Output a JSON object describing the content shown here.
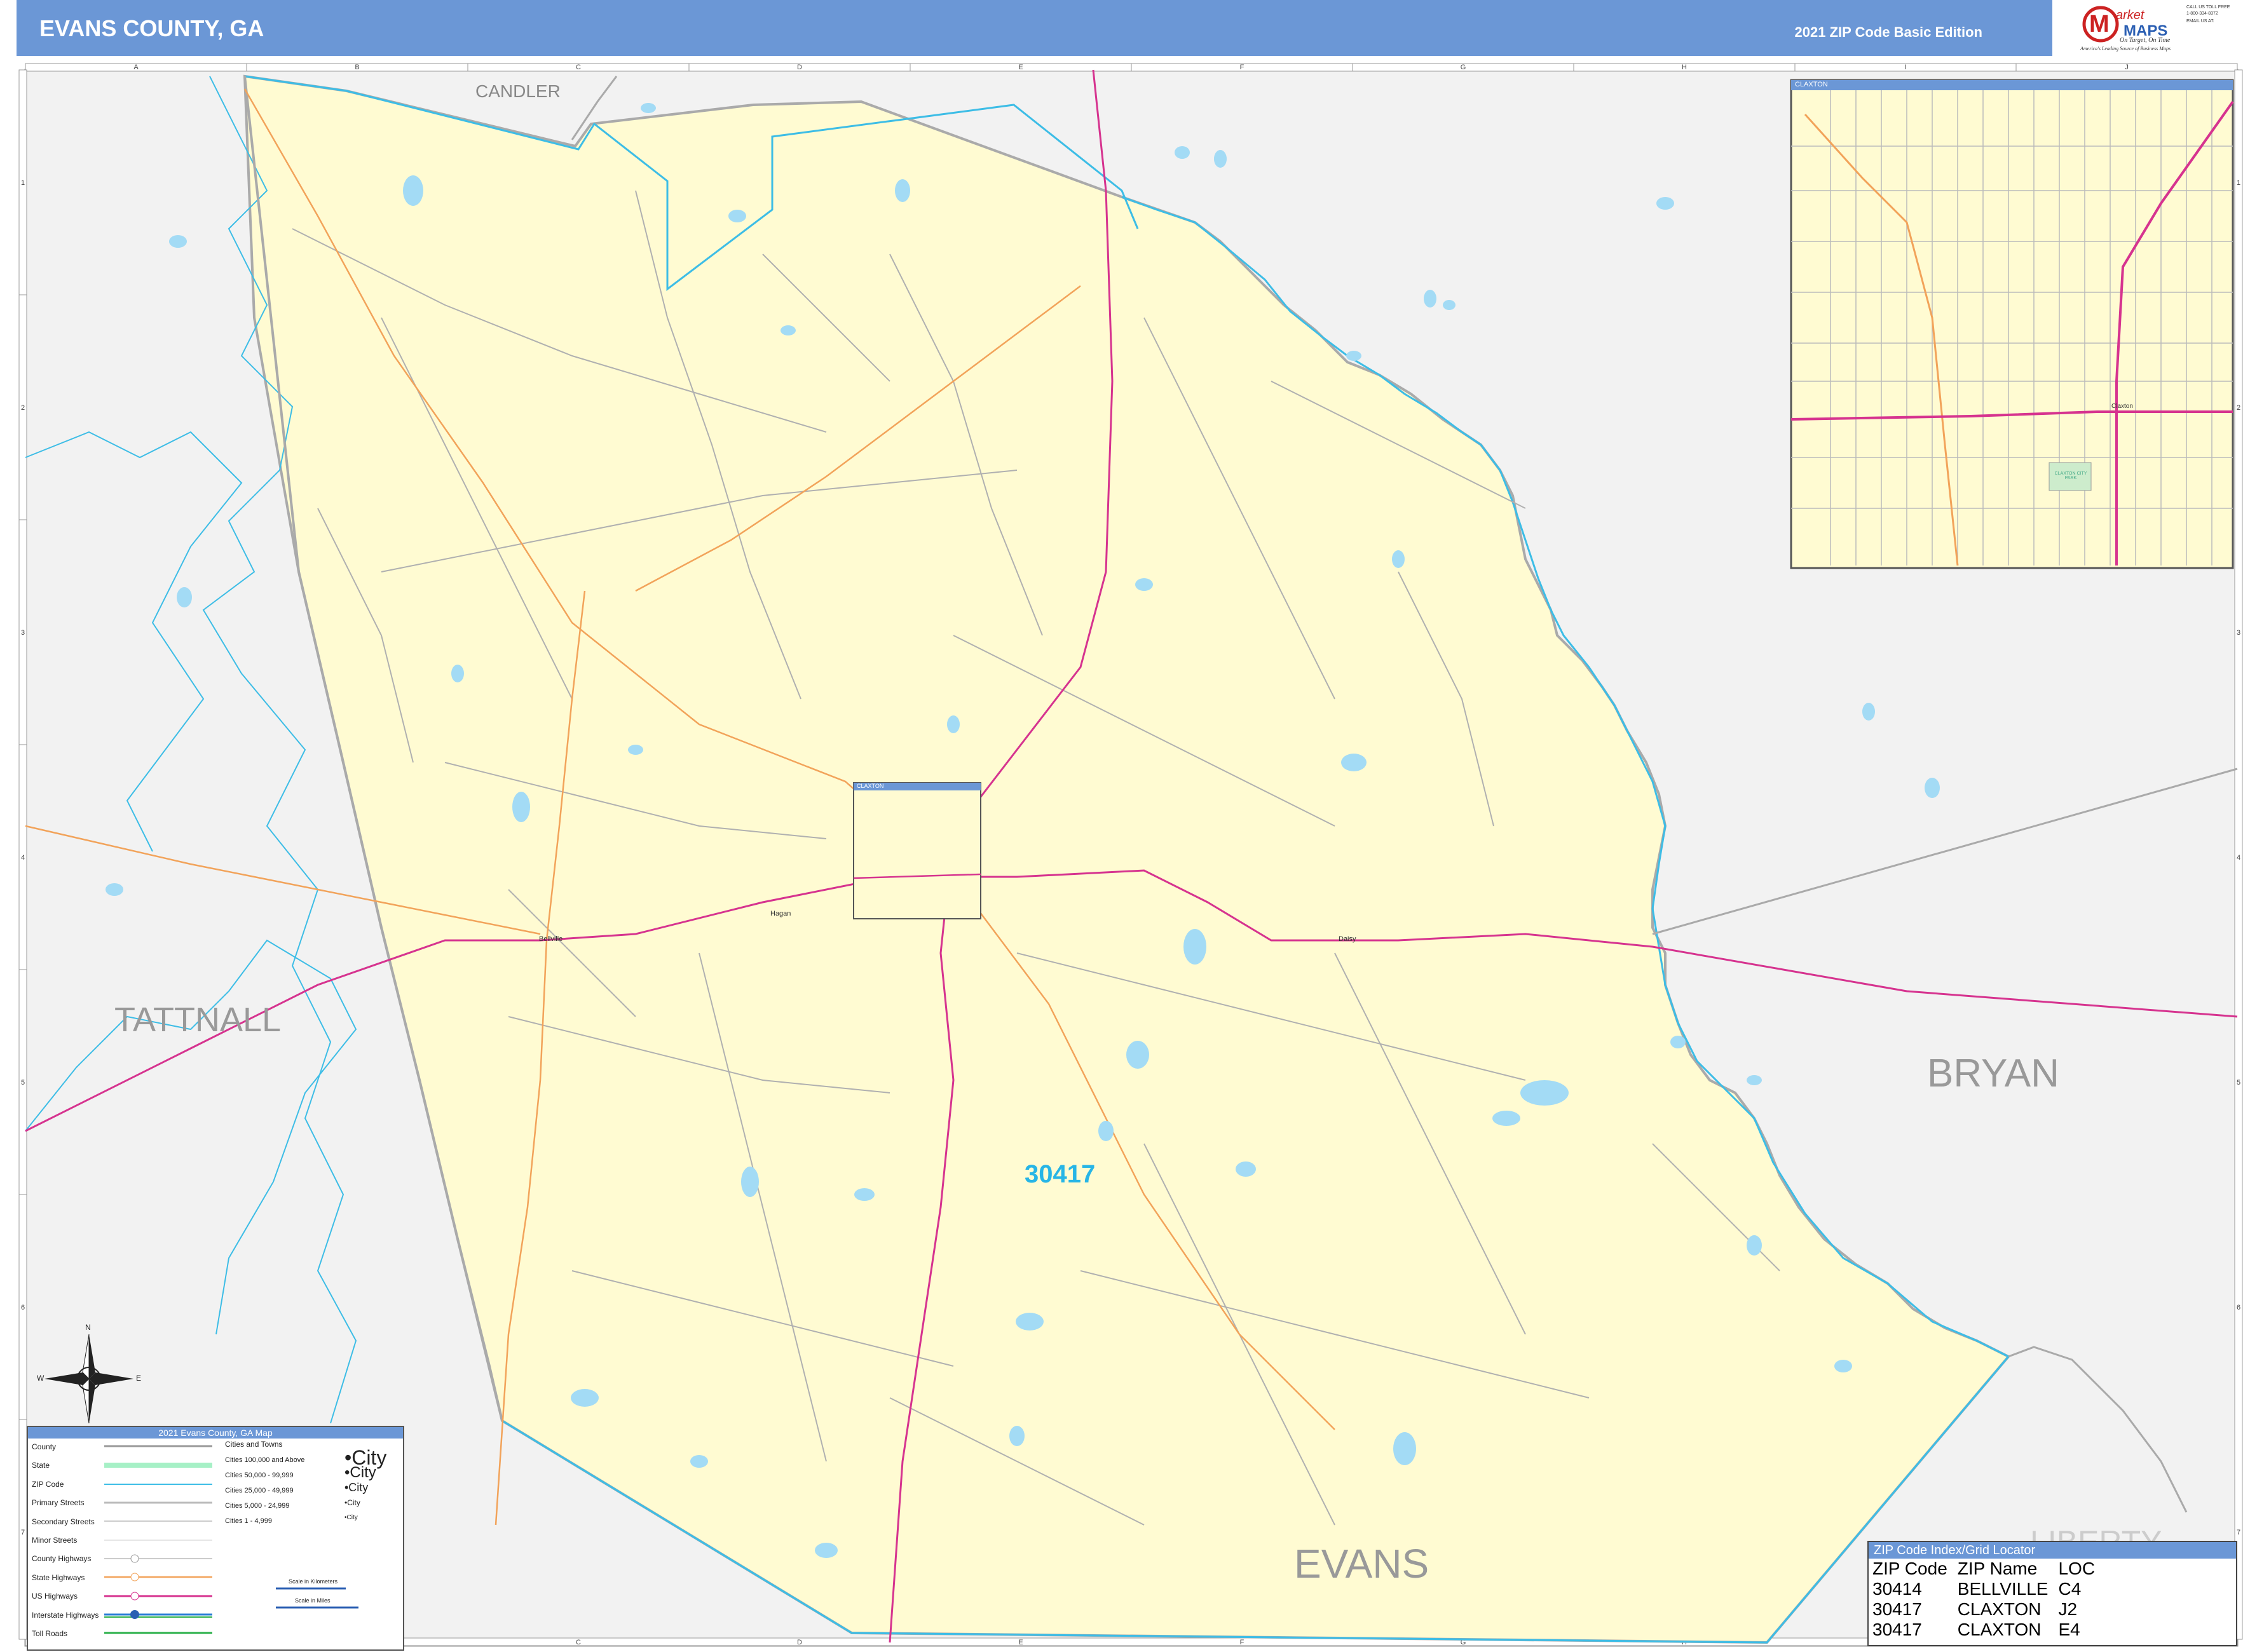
{
  "header": {
    "title": "EVANS COUNTY, GA",
    "edition": "2021 ZIP Code Basic Edition"
  },
  "logo": {
    "brand_top": "arket",
    "brand_bottom": "MAPS",
    "tagline": "On Target, On Time",
    "subline": "America's Leading Source of Business Maps",
    "call": "CALL US TOLL FREE",
    "phone": "1-800-334-8372",
    "email_label": "EMAIL US AT:",
    "color_brand": "#cc2222"
  },
  "map": {
    "county_labels": {
      "candler": "CANDLER",
      "tattnall": "TATTNALL",
      "bryan": "BRYAN",
      "evans": "EVANS",
      "liberty": "LIBERTY"
    },
    "zip_label": "30417",
    "grid_columns": [
      "A",
      "B",
      "C",
      "D",
      "E",
      "F",
      "G",
      "H",
      "I",
      "J"
    ],
    "grid_rows": [
      "1",
      "2",
      "3",
      "4",
      "5",
      "6",
      "7"
    ],
    "places": {
      "claxton": "Claxton",
      "hagan": "Hagan",
      "bellville": "Bellville",
      "daisy": "Daisy"
    },
    "compass": {
      "n": "N",
      "s": "S",
      "e": "E",
      "w": "W"
    },
    "colors": {
      "county_fill": "#fffbd2",
      "outside_fill": "#f2f2f2",
      "water": "#a3dbf5",
      "zip_boundary": "#3dbde6",
      "us_highway": "#d6338f",
      "state_highway": "#f2a35a",
      "county_line": "#aaaaaa"
    }
  },
  "inset": {
    "title": "CLAXTON",
    "city_label": "Claxton",
    "park_label": "CLAXTON CITY PARK"
  },
  "small_inset": {
    "title": "CLAXTON"
  },
  "legend": {
    "title": "2021 Evans County, GA Map",
    "items": [
      "County",
      "State",
      "ZIP Code",
      "Primary Streets",
      "Secondary Streets",
      "Minor Streets",
      "County Highways",
      "State Highways",
      "US Highways",
      "Interstate Highways",
      "Toll Roads"
    ],
    "cities_title": "Cities and Towns",
    "city_classes": [
      "Cities 100,000 and Above",
      "Cities 50,000 - 99,999",
      "Cities 25,000 - 49,999",
      "Cities 5,000 - 24,999",
      "Cities 1 - 4,999"
    ],
    "city_samples": [
      "City",
      "City",
      "City",
      "City",
      "City"
    ],
    "scale_km": "Scale in Kilometers",
    "scale_mi": "Scale in Miles"
  },
  "zip_index": {
    "title": "ZIP Code Index/Grid Locator",
    "headers": [
      "ZIP Code",
      "ZIP Name",
      "LOC"
    ],
    "rows": [
      [
        "30414",
        "BELLVILLE",
        "C4"
      ],
      [
        "30417",
        "CLAXTON",
        "J2"
      ],
      [
        "30417",
        "CLAXTON",
        "E4"
      ]
    ]
  }
}
